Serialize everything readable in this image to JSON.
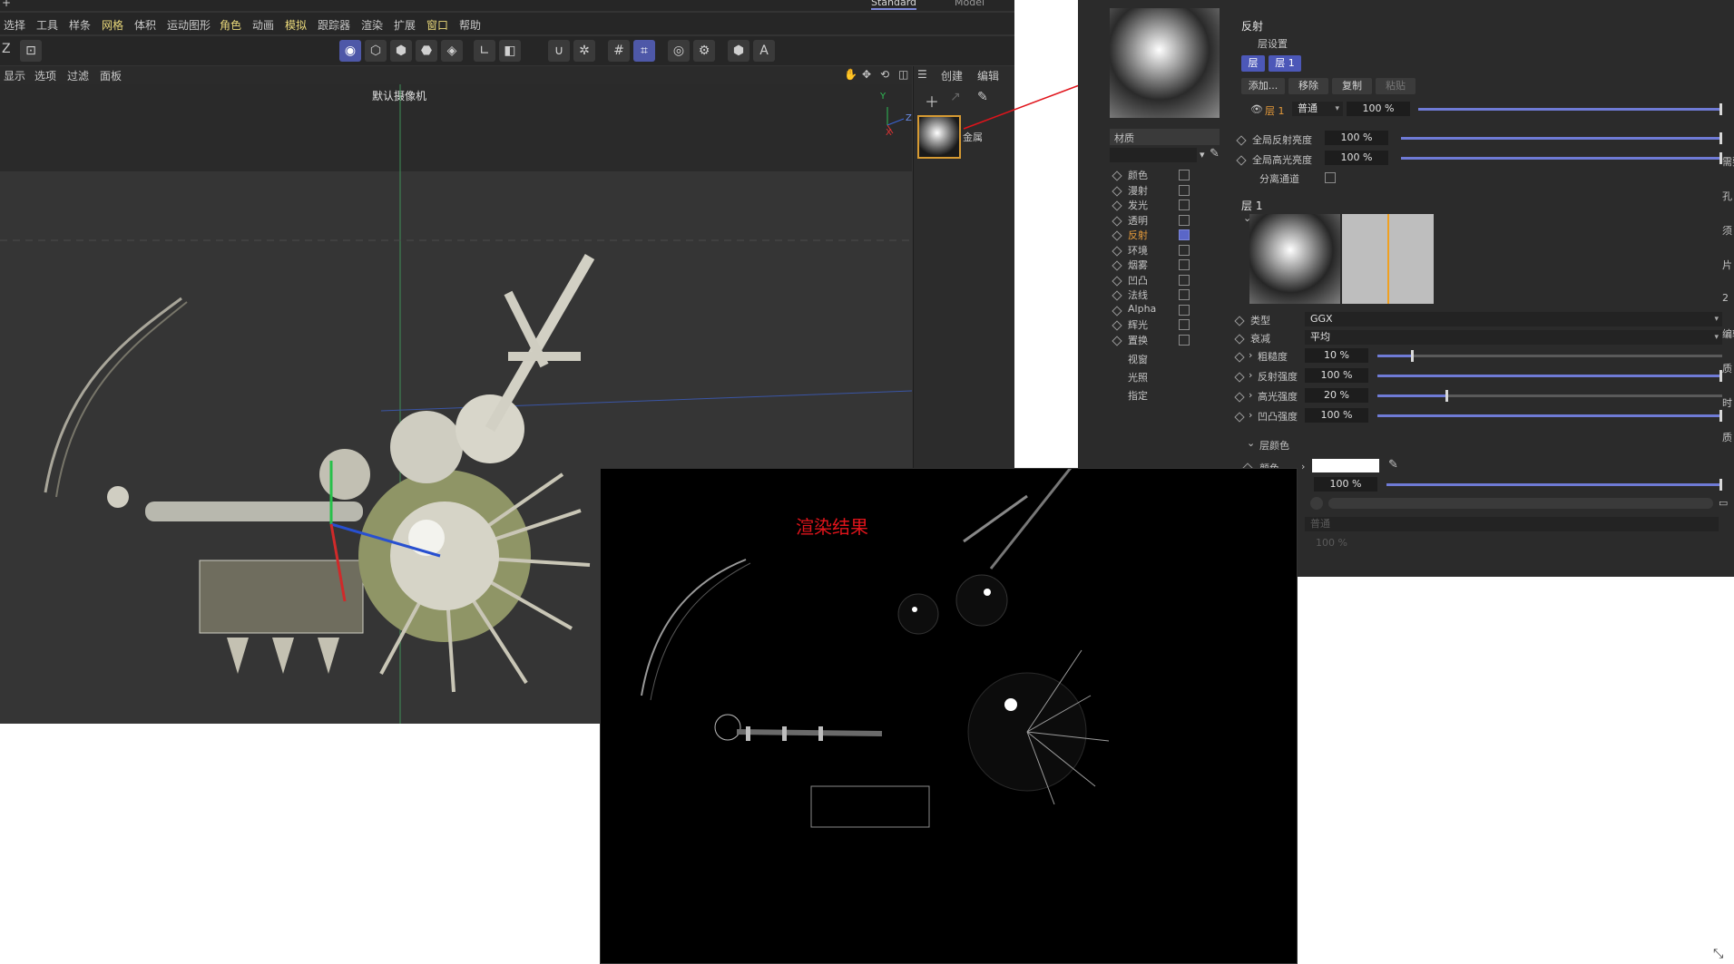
{
  "workspace": {
    "tabs": [
      "Standard",
      "Model"
    ],
    "active": "Standard"
  },
  "menubar": [
    "选择",
    "工具",
    "样条",
    "网格",
    "体积",
    "运动图形",
    "角色",
    "动画",
    "模拟",
    "跟踪器",
    "渲染",
    "扩展",
    "窗口",
    "帮助"
  ],
  "menubar_highlighted": [
    "网格",
    "角色",
    "模拟",
    "窗口"
  ],
  "toolbar": {
    "left_label": "Z",
    "icons": [
      "model-mode-icon",
      "point-mode-icon",
      "edge-mode-icon",
      "polygon-mode-icon",
      "uv-mode-icon",
      "axis-icon",
      "solo-icon",
      "snap-magnet-icon",
      "snap-settings-icon",
      "grid-icon",
      "workplane-icon",
      "render-icon",
      "render-settings-icon",
      "hex-icon",
      "a-icon"
    ]
  },
  "viewport": {
    "menu": [
      "显示",
      "选项",
      "过滤",
      "面板"
    ],
    "camera_label": "默认摄像机",
    "axis_labels": {
      "y": "Y",
      "z": "Z",
      "x": "X"
    }
  },
  "object_panel": {
    "menu": [
      "创建",
      "编辑"
    ],
    "material_name": "金属"
  },
  "attribute_manager": {
    "section_title": "反射",
    "section_sub": "层设置",
    "layer_tabs": [
      "层",
      "层 1"
    ],
    "layer_buttons": [
      "添加...",
      "移除",
      "复制",
      "粘贴"
    ],
    "layer_row": {
      "name": "层 1",
      "blend": "普通",
      "value": "100 %",
      "fraction": 1.0
    },
    "global_rows": [
      {
        "label": "全局反射亮度",
        "value": "100 %",
        "fraction": 1.0
      },
      {
        "label": "全局高光亮度",
        "value": "100 %",
        "fraction": 1.0
      }
    ],
    "separate_pass_label": "分离通道",
    "material_label": "材质",
    "channels": [
      {
        "label": "颜色",
        "checked": false
      },
      {
        "label": "漫射",
        "checked": false
      },
      {
        "label": "发光",
        "checked": false
      },
      {
        "label": "透明",
        "checked": false
      },
      {
        "label": "反射",
        "checked": true,
        "active": true
      },
      {
        "label": "环境",
        "checked": false
      },
      {
        "label": "烟雾",
        "checked": false
      },
      {
        "label": "凹凸",
        "checked": false
      },
      {
        "label": "法线",
        "checked": false
      },
      {
        "label": "Alpha",
        "checked": false
      },
      {
        "label": "辉光",
        "checked": false
      },
      {
        "label": "置换",
        "checked": false
      }
    ],
    "extra_items": [
      "视窗",
      "光照",
      "指定"
    ],
    "layer1_title": "层 1",
    "props": [
      {
        "label": "类型",
        "value": "GGX",
        "kind": "dropdown"
      },
      {
        "label": "衰减",
        "value": "平均",
        "kind": "dropdown"
      },
      {
        "label": "粗糙度",
        "value": "10 %",
        "fraction": 0.1,
        "kind": "slider"
      },
      {
        "label": "反射强度",
        "value": "100 %",
        "fraction": 1.0,
        "kind": "slider"
      },
      {
        "label": "高光强度",
        "value": "20 %",
        "fraction": 0.2,
        "kind": "slider"
      },
      {
        "label": "凹凸强度",
        "value": "100 %",
        "fraction": 1.0,
        "kind": "slider"
      }
    ],
    "layer_color_title": "层颜色",
    "color_label": "颜色",
    "color_value": "#ffffff",
    "brightness_value": "100 %",
    "dim_labels": [
      "普通",
      "100 %"
    ],
    "right_edge_glyphs": [
      "需要",
      "孔",
      "须",
      "片",
      "2",
      "编辑",
      "质",
      "时",
      "质"
    ]
  },
  "render_window": {
    "label": "渲染结果"
  },
  "colors": {
    "accent": "#4c58b8",
    "annotation_red": "#e0141b",
    "ui_dark": "#2b2b2b"
  }
}
